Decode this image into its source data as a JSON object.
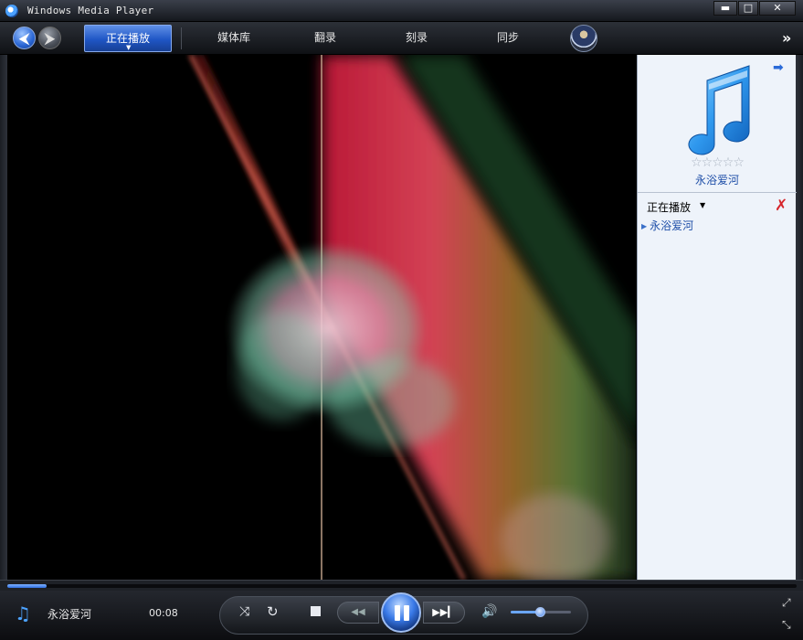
{
  "window": {
    "title": "Windows Media Player",
    "minimize": "▬",
    "maximize": "□",
    "close": "✕"
  },
  "nav": {
    "back": "⮜",
    "forward": "⮞",
    "tabs": [
      {
        "label": "正在播放",
        "active": true
      },
      {
        "label": "媒体库",
        "active": false
      },
      {
        "label": "翻录",
        "active": false
      },
      {
        "label": "刻录",
        "active": false
      },
      {
        "label": "同步",
        "active": false
      }
    ],
    "overflow": "»"
  },
  "pane": {
    "arrow": "➡",
    "rating_stars": "☆☆☆☆☆",
    "track_title": "永浴爱河",
    "playlist_header": "正在播放",
    "dropdown": "▼",
    "clear": "✗",
    "items": [
      "永浴爱河"
    ]
  },
  "seek": {
    "progress": 0.05
  },
  "status": {
    "track": "永浴爱河",
    "time": "00:08"
  },
  "controls": {
    "shuffle": "⤨",
    "repeat": "↻",
    "prev": "◀◀",
    "next": "▶▶▎",
    "mute": "🔊",
    "volume": 0.5,
    "fullscreen": "⤢",
    "compact": "⤡"
  },
  "colors": {
    "accent": "#2f6fe0",
    "active_tab": "#1f56c5",
    "track_text": "#1f4fa8",
    "clear_red": "#d6262c"
  }
}
